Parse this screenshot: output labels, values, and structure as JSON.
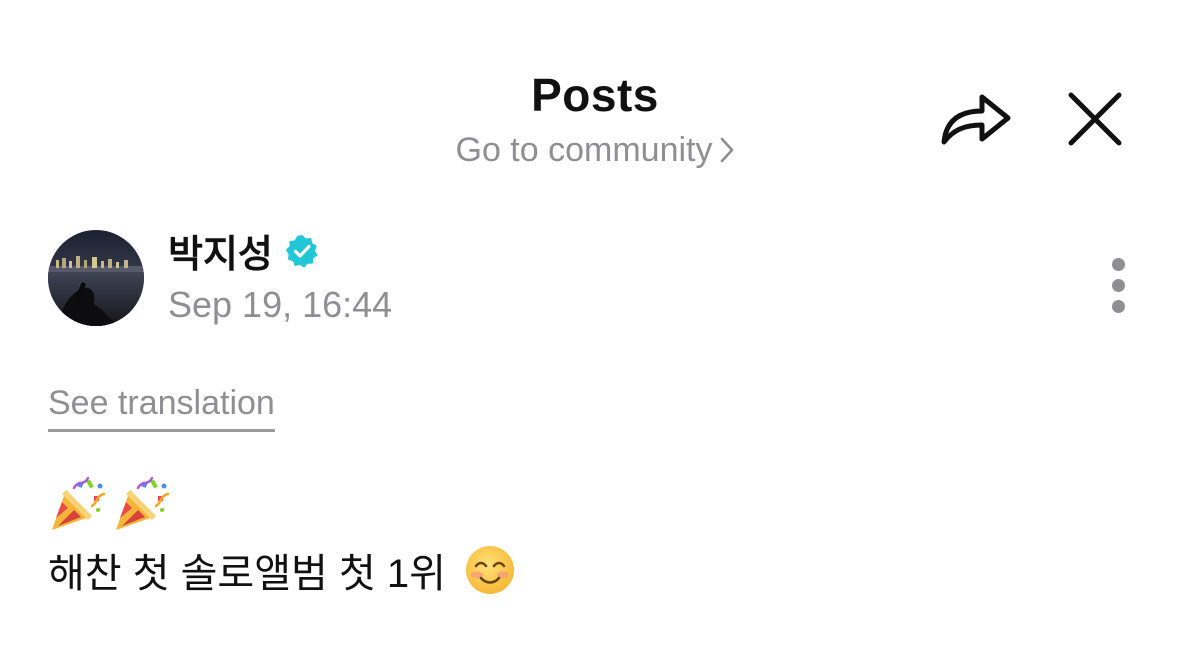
{
  "header": {
    "title": "Posts",
    "community_link": "Go to community",
    "icons": {
      "share": "share-arrow-icon",
      "close": "close-icon",
      "chevron": "chevron-right-icon"
    }
  },
  "post": {
    "author": {
      "name": "박지성",
      "verified": true,
      "avatar": "avatar-night-city-photo"
    },
    "timestamp": "Sep 19, 16:44",
    "more_icon": "more-vertical-icon",
    "see_translation": "See translation",
    "emoji_line": [
      "party-popper-icon",
      "party-popper-icon"
    ],
    "body_text": "해찬 첫 솔로앨범 첫 1위",
    "trailing_emoji": "smiling-face-icon"
  },
  "colors": {
    "text_primary": "#111111",
    "text_secondary": "#8e8e93",
    "verified_badge": "#21c7d6",
    "background": "#ffffff"
  }
}
